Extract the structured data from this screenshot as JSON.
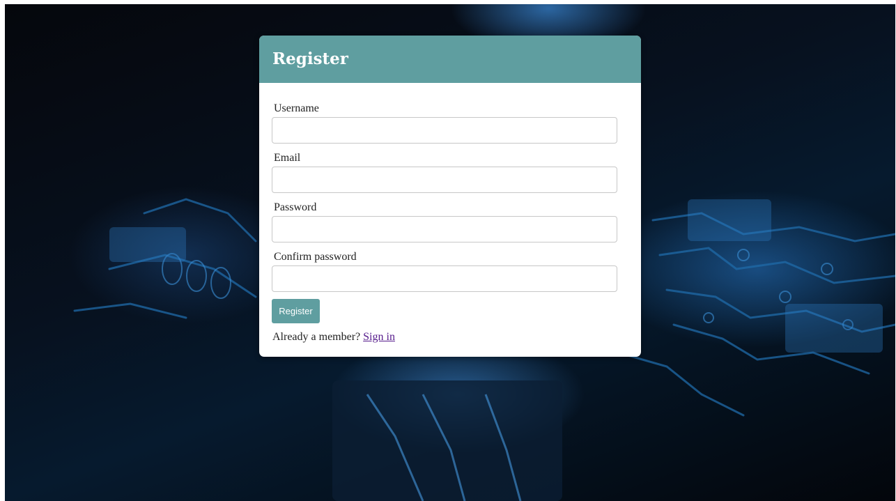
{
  "form": {
    "title": "Register",
    "fields": [
      {
        "label": "Username",
        "value": "",
        "placeholder": ""
      },
      {
        "label": "Email",
        "value": "",
        "placeholder": ""
      },
      {
        "label": "Password",
        "value": "",
        "placeholder": ""
      },
      {
        "label": "Confirm password",
        "value": "",
        "placeholder": ""
      }
    ],
    "submit_label": "Register",
    "member_prompt": "Already a member?",
    "signin_link": "Sign in"
  },
  "colors": {
    "accent": "#5f9ea0",
    "link": "#551a8b",
    "background": "#061a2e"
  }
}
